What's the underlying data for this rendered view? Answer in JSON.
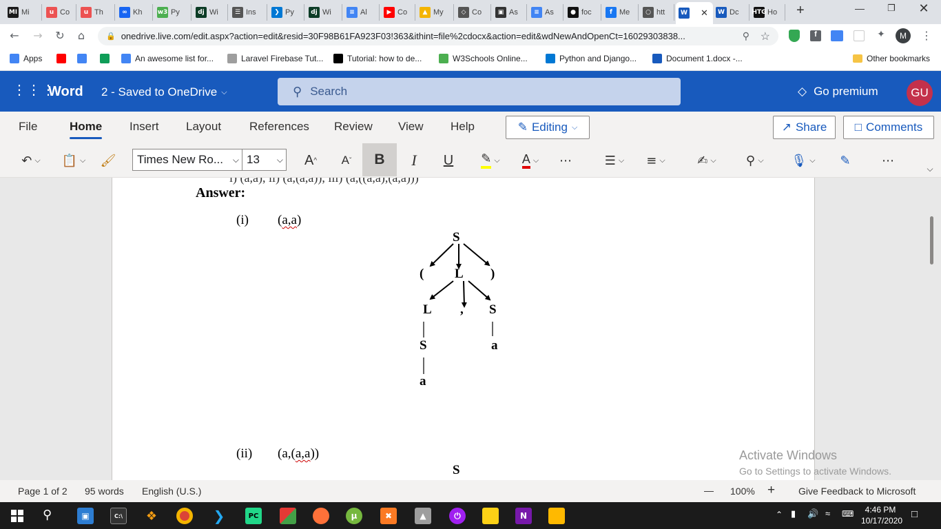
{
  "browser": {
    "tabs": [
      {
        "label": "Mi",
        "icon": "mi-icon",
        "color": "#1a1a1a"
      },
      {
        "label": "Co",
        "icon": "udemy-icon",
        "color": "#ec5252"
      },
      {
        "label": "Th",
        "icon": "udemy-icon",
        "color": "#ec5252"
      },
      {
        "label": "Kh",
        "icon": "infinity-icon",
        "color": "#1865f2"
      },
      {
        "label": "Py",
        "icon": "w3schools-icon",
        "color": "#4caf50"
      },
      {
        "label": "Wi",
        "icon": "django-icon",
        "color": "#0c3c26"
      },
      {
        "label": "Ins",
        "icon": "document-icon",
        "color": "#555"
      },
      {
        "label": "Py",
        "icon": "vscode-icon",
        "color": "#0078d4"
      },
      {
        "label": "Wi",
        "icon": "django-icon",
        "color": "#0c3c26"
      },
      {
        "label": "Al",
        "icon": "docs-icon",
        "color": "#4285f4"
      },
      {
        "label": "Co",
        "icon": "youtube-icon",
        "color": "#ff0000"
      },
      {
        "label": "My",
        "icon": "drive-icon",
        "color": "#f4b400"
      },
      {
        "label": "Co",
        "icon": "diamond-icon",
        "color": "#555"
      },
      {
        "label": "As",
        "icon": "person-icon",
        "color": "#333"
      },
      {
        "label": "As",
        "icon": "docs-icon",
        "color": "#4285f4"
      },
      {
        "label": "foc",
        "icon": "github-icon",
        "color": "#111"
      },
      {
        "label": "Me",
        "icon": "facebook-icon",
        "color": "#1877f2"
      },
      {
        "label": "htt",
        "icon": "globe-icon",
        "color": "#555"
      },
      {
        "label": "",
        "icon": "word-icon",
        "color": "#185abd",
        "active": true
      },
      {
        "label": "Dc",
        "icon": "word-icon",
        "color": "#185abd"
      },
      {
        "label": "Ho",
        "icon": "htg-icon",
        "color": "#111"
      }
    ],
    "url": "onedrive.live.com/edit.aspx?action=edit&resid=30F98B61FA923F03!363&ithint=file%2cdocx&action=edit&wdNewAndOpenCt=16029303838...",
    "profile_initial": "M",
    "bookmarks": [
      {
        "label": "Apps",
        "icon": "apps-grid-icon"
      },
      {
        "label": "",
        "icon": "youtube-icon"
      },
      {
        "label": "",
        "icon": "translate-icon"
      },
      {
        "label": "",
        "icon": "drive-icon"
      },
      {
        "label": "An awesome list for...",
        "icon": "bar-chart-icon"
      },
      {
        "label": "Laravel Firebase Tut...",
        "icon": "appdividend-icon"
      },
      {
        "label": "Tutorial: how to de...",
        "icon": "medium-icon"
      },
      {
        "label": "W3Schools Online...",
        "icon": "w3schools-icon"
      },
      {
        "label": "Python and Django...",
        "icon": "vscode-icon"
      },
      {
        "label": "Document 1.docx -...",
        "icon": "word-icon"
      }
    ],
    "other_bookmarks": "Other bookmarks"
  },
  "word": {
    "app_name": "Word",
    "doc_title": "2  -  Saved to OneDrive",
    "search_placeholder": "Search",
    "go_premium": "Go premium",
    "user_initials": "GU",
    "ribbon_tabs": [
      "File",
      "Home",
      "Insert",
      "Layout",
      "References",
      "Review",
      "View",
      "Help"
    ],
    "editing_label": "Editing",
    "share_label": "Share",
    "comments_label": "Comments",
    "font_name": "Times New Ro...",
    "font_size": "13",
    "accent": "#185abd",
    "user_color": "#c4314b"
  },
  "document": {
    "cut_line": "i) (a,a), ii) (a,(a,a)), iii) (a,((a,a),(a,a)))",
    "answer_label": "Answer:",
    "items": [
      {
        "num": "(i)",
        "expr_open": "(",
        "expr_word": "a,a",
        "expr_close": ")"
      },
      {
        "num": "(ii)",
        "expr_open": "(a,(",
        "expr_word": "a,a",
        "expr_close": "))"
      }
    ],
    "tree1": {
      "nodes": [
        "S",
        "(",
        "L",
        ")",
        "L",
        ",",
        "S",
        "S",
        "a",
        "a"
      ]
    },
    "tree2_root": "S",
    "watermark_title": "Activate Windows",
    "watermark_sub": "Go to Settings to activate Windows."
  },
  "status": {
    "page": "Page 1 of 2",
    "words": "95 words",
    "language": "English (U.S.)",
    "zoom_minus": "—",
    "zoom": "100%",
    "zoom_plus": "+",
    "feedback": "Give Feedback to Microsoft"
  },
  "taskbar": {
    "time": "4:46 PM",
    "date": "10/17/2020"
  }
}
